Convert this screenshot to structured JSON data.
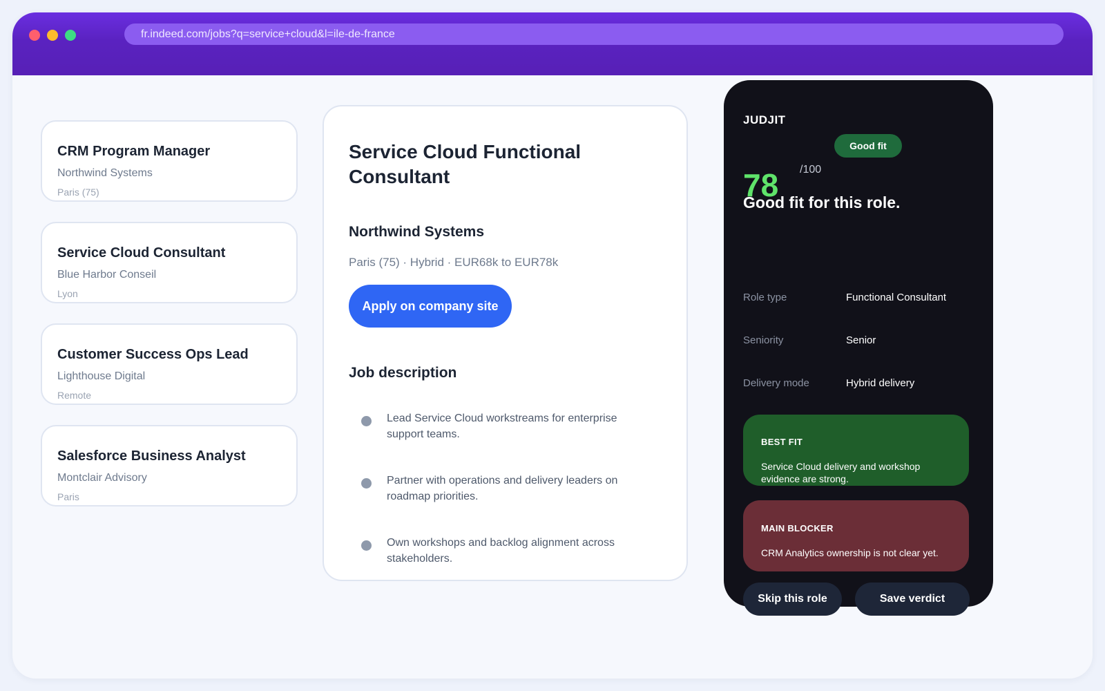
{
  "browser": {
    "url": "fr.indeed.com/jobs?q=service+cloud&l=ile-de-france"
  },
  "job_list": [
    {
      "title": "CRM Program Manager",
      "company": "Northwind Systems",
      "location": "Paris (75)"
    },
    {
      "title": "Service Cloud Consultant",
      "company": "Blue Harbor Conseil",
      "location": "Lyon"
    },
    {
      "title": "Customer Success Ops Lead",
      "company": "Lighthouse Digital",
      "location": "Remote"
    },
    {
      "title": "Salesforce Business Analyst",
      "company": "Montclair Advisory",
      "location": "Paris"
    }
  ],
  "detail": {
    "title": "Service Cloud Functional Consultant",
    "company": "Northwind Systems",
    "meta": "Paris (75) · Hybrid · EUR68k to EUR78k",
    "apply_label": "Apply on company site",
    "description_heading": "Job description",
    "bullets": [
      "Lead Service Cloud workstreams for enterprise support teams.",
      "Partner with operations and delivery leaders on roadmap priorities.",
      "Own workshops and backlog alignment across stakeholders."
    ]
  },
  "judjit": {
    "brand": "JUDJIT",
    "badge": "Good fit",
    "score": "78",
    "score_denominator": "/100",
    "verdict": "Good fit for this role.",
    "attributes": [
      {
        "label": "Role type",
        "value": "Functional Consultant"
      },
      {
        "label": "Seniority",
        "value": "Senior"
      },
      {
        "label": "Delivery mode",
        "value": "Hybrid delivery"
      }
    ],
    "best_fit": {
      "heading": "BEST FIT",
      "text": "Service Cloud delivery and workshop evidence are strong."
    },
    "main_blocker": {
      "heading": "MAIN BLOCKER",
      "text": "CRM Analytics ownership is not clear yet."
    },
    "skip_label": "Skip this role",
    "save_label": "Save verdict"
  },
  "colors": {
    "browser_bar": "#5a22c0",
    "url_bar": "#8b5cf0",
    "apply_button": "#2f66f4",
    "score": "#5fe36a",
    "good_fit_badge": "#1f6b3c",
    "best_fit_card": "#1f5e2a",
    "blocker_card": "#6b2e37",
    "panel_bg": "#111119"
  }
}
